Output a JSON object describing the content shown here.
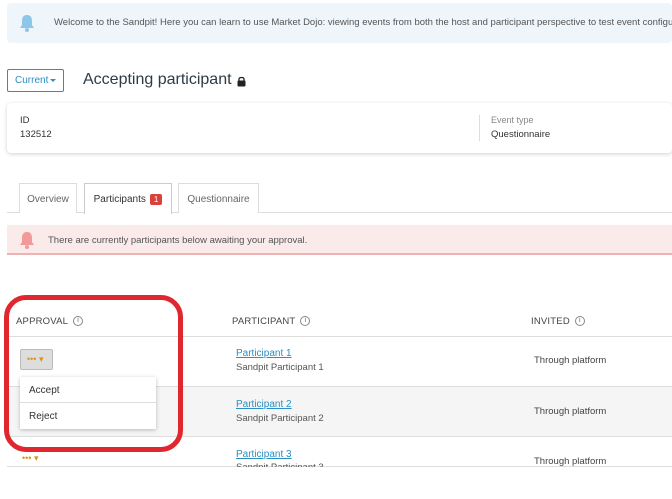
{
  "banner": {
    "text": "Welcome to the Sandpit! Here you can learn to use Market Dojo: viewing events from both the host and participant perspective to test event configu"
  },
  "header": {
    "version_button": "Current",
    "title": "Accepting participant"
  },
  "info": {
    "id_label": "ID",
    "id_value": "132512",
    "event_type_label": "Event type",
    "event_type_value": "Questionnaire"
  },
  "tabs": [
    {
      "label": "Overview"
    },
    {
      "label": "Participants",
      "badge": "1"
    },
    {
      "label": "Questionnaire"
    }
  ],
  "alert": {
    "text": "There are currently participants below awaiting your approval."
  },
  "table": {
    "headers": [
      "APPROVAL",
      "PARTICIPANT",
      "INVITED"
    ],
    "rows": [
      {
        "name": "Participant 1",
        "company": "Sandpit Participant 1",
        "invited": "Through platform"
      },
      {
        "name": "Participant 2",
        "company": "Sandpit Participant 2",
        "invited": "Through platform"
      },
      {
        "name": "Participant 3",
        "company": "Sandpit Participant 3",
        "invited": "Through platform"
      }
    ]
  },
  "approval_button_label": "••• ▾",
  "dropdown": {
    "accept": "Accept",
    "reject": "Reject"
  },
  "colors": {
    "accent": "#2a8fc4",
    "alert_bg": "#fbeaea",
    "highlight": "#e0262f",
    "pending": "#e0901a"
  }
}
